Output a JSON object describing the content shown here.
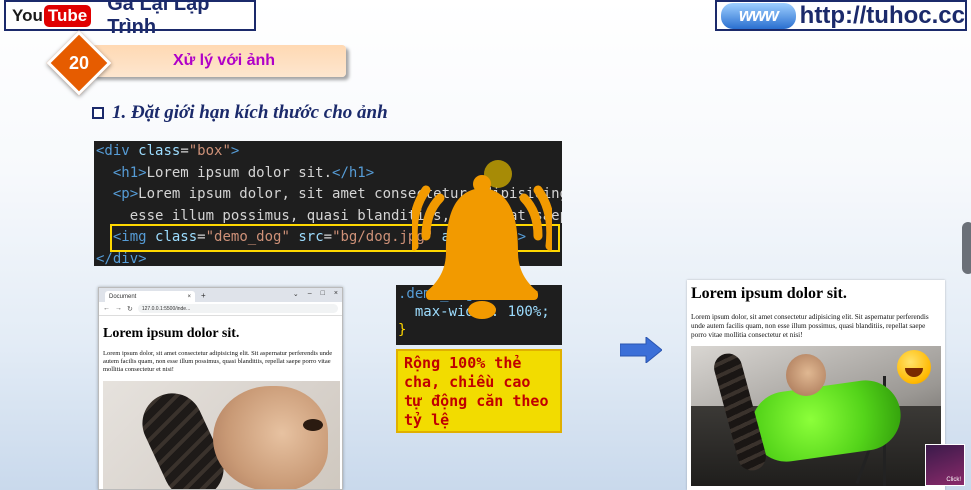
{
  "header": {
    "youtube_logo": {
      "you": "You",
      "tube": "Tube"
    },
    "channel_name": "Gà Lại Lập Trình",
    "site_logo_text": "www",
    "site_url": "http://tuhoc.cc"
  },
  "lesson": {
    "number": "20",
    "title": "Xử lý với ảnh"
  },
  "section": {
    "heading": "1. Đặt giới hạn kích thước cho ảnh"
  },
  "code_block": {
    "lines": [
      "<div class=\"box\">",
      "  <h1>Lorem ipsum dolor sit.</h1>",
      "  <p>Lorem ipsum dolor, sit amet consectetur adipisicing",
      "    esse illum possimus, quasi blanditiis, repellat saep",
      "  <img class=\"demo_dog\" src=\"bg/dog.jpg\" alt=\"chó\">",
      "</div>"
    ]
  },
  "css_snippet": {
    "lines": [
      ".demo_dog {",
      "  max-width: 100%;",
      "}"
    ]
  },
  "note": {
    "text": "Rộng 100% thẻ cha, chiều cao tự động căn theo tỷ lệ"
  },
  "browser": {
    "tab_title": "Document",
    "tab_close": "×",
    "new_tab": "+",
    "window_controls": [
      "⌄",
      "–",
      "□",
      "×"
    ],
    "nav": [
      "←",
      "→",
      "↻"
    ],
    "address": "127.0.0.1:5500/inde...",
    "page_heading": "Lorem ipsum dolor sit.",
    "page_paragraph": "Lorem ipsum dolor, sit amet consectetur adipisicing elit. Sit aspernatur perferendis unde autem facilis quam, non esse illum possimus, quasi blanditiis, repellat saepe porro vitae mollitia consectetur et nisi!"
  },
  "result": {
    "heading": "Lorem ipsum dolor sit.",
    "paragraph": "Lorem ipsum dolor, sit amet consectetur adipisicing elit. Sit aspernatur perferendis unde autem facilis quam, non esse illum possimus, quasi blanditiis, repellat saepe porro vitae mollitia consectetur et nisi!"
  },
  "corner_badge": {
    "label": "Click!"
  },
  "colors": {
    "brand_navy": "#1b2a6b",
    "lesson_orange": "#e65c00",
    "lesson_title": "#b000c8",
    "note_bg": "#f2dc00",
    "note_text": "#c00000",
    "arrow_blue": "#3b6fd8",
    "bell_orange": "#f29a00",
    "highlight_yellow": "#ffd800"
  },
  "icons": [
    "youtube-logo-icon",
    "www-globe-icon",
    "checkbox-icon",
    "right-arrow-icon",
    "bell-icon",
    "laughing-emoji-icon"
  ]
}
